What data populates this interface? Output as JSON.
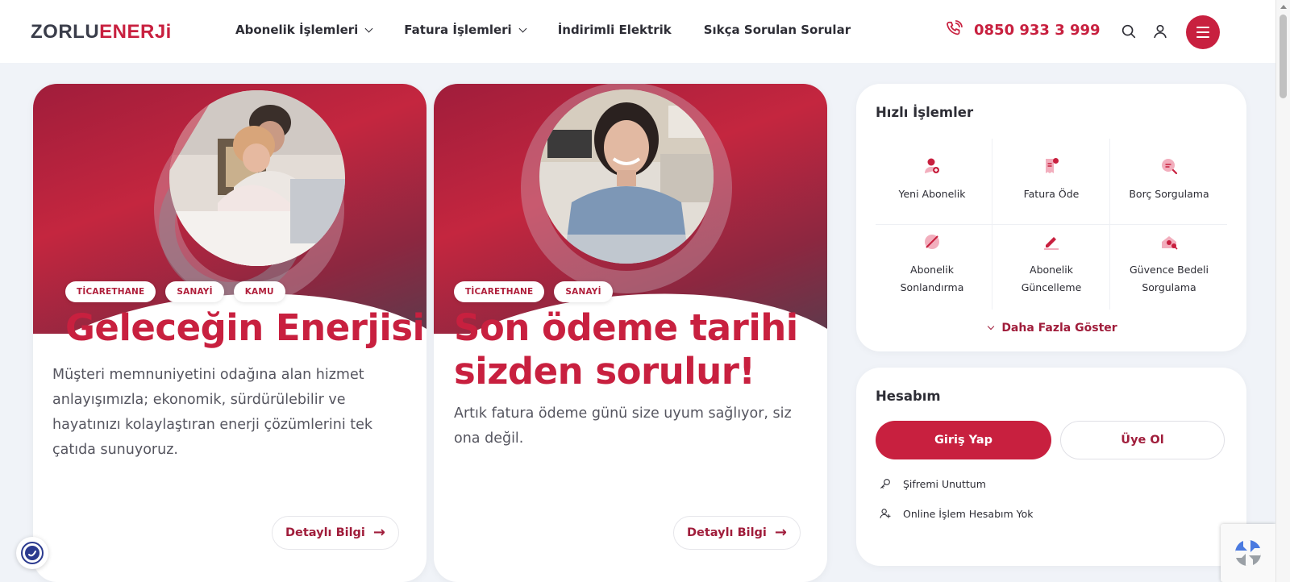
{
  "brand": {
    "logo_part1": "ZORLU",
    "logo_part2": "ENERJi"
  },
  "nav": [
    {
      "label": "Abonelik İşlemleri",
      "has_dropdown": true
    },
    {
      "label": "Fatura İşlemleri",
      "has_dropdown": true
    },
    {
      "label": "İndirimli Elektrik",
      "has_dropdown": false
    },
    {
      "label": "Sıkça Sorulan Sorular",
      "has_dropdown": false
    }
  ],
  "header": {
    "phone": "0850 933 3 999",
    "icons": [
      "phone-icon",
      "search-icon",
      "user-icon",
      "menu-icon"
    ]
  },
  "cards": [
    {
      "tags": [
        "TİCARETHANE",
        "SANAYİ",
        "KAMU"
      ],
      "title": "Geleceğin Enerjisi",
      "description": "Müşteri memnuniyetini odağına alan hizmet anlayışımızla; ekonomik, sürdürülebilir ve hayatınızı kolaylaştıran enerji çözümlerini tek çatıda sunuyoruz.",
      "button_label": "Detaylı Bilgi"
    },
    {
      "tags": [
        "TİCARETHANE",
        "SANAYİ"
      ],
      "title_line1": "Son ödeme tarihi",
      "title_line2": "sizden sorulur!",
      "description": "Artık fatura ödeme günü size uyum sağlıyor, siz ona değil.",
      "button_label": "Detaylı Bilgi"
    }
  ],
  "quick_actions": {
    "title": "Hızlı İşlemler",
    "items": [
      {
        "label": "Yeni Abonelik",
        "icon": "new-subscription-icon"
      },
      {
        "label": "Fatura Öde",
        "icon": "bill-pay-icon"
      },
      {
        "label": "Borç Sorgulama",
        "icon": "debt-query-icon"
      },
      {
        "label_line1": "Abonelik",
        "label_line2": "Sonlandırma",
        "icon": "end-subscription-icon"
      },
      {
        "label_line1": "Abonelik",
        "label_line2": "Güncelleme",
        "icon": "update-subscription-icon"
      },
      {
        "label_line1": "Güvence Bedeli",
        "label_line2": "Sorgulama",
        "icon": "deposit-query-icon"
      }
    ],
    "more_label": "Daha Fazla Göster"
  },
  "account": {
    "title": "Hesabım",
    "login_label": "Giriş Yap",
    "register_label": "Üye Ol",
    "forgot_password": "Şifremi Unuttum",
    "no_account": "Online İşlem Hesabım Yok"
  },
  "colors": {
    "brand_red": "#c8203f",
    "dark_text": "#2d2d35",
    "background": "#f0f3f8"
  }
}
